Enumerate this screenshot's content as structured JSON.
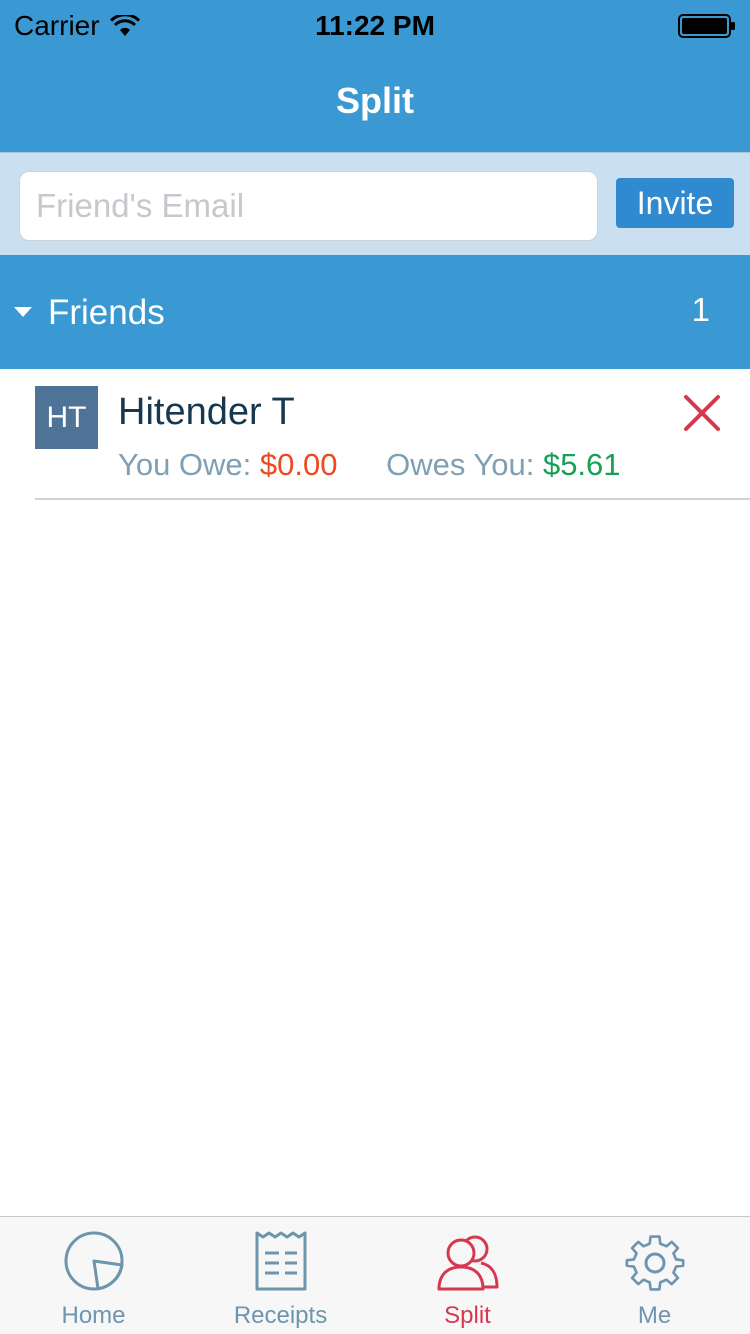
{
  "status_bar": {
    "carrier": "Carrier",
    "time": "11:22 PM"
  },
  "nav": {
    "title": "Split"
  },
  "invite": {
    "email_placeholder": "Friend's Email",
    "email_value": "",
    "button_label": "Invite"
  },
  "friends_section": {
    "title": "Friends",
    "count": "1",
    "friends": [
      {
        "initials": "HT",
        "name": "Hitender T",
        "you_owe_label": "You Owe:",
        "you_owe": "$0.00",
        "owes_you_label": "Owes You:",
        "owes_you": "$5.61"
      }
    ]
  },
  "tabbar": {
    "tabs": [
      {
        "label": "Home",
        "icon": "home-pie-icon"
      },
      {
        "label": "Receipts",
        "icon": "receipt-icon"
      },
      {
        "label": "Split",
        "icon": "friends-icon",
        "active": true
      },
      {
        "label": "Me",
        "icon": "gear-icon"
      }
    ]
  },
  "colors": {
    "primary": "#3a98d2",
    "owe": "#ec4a1e",
    "owed": "#18a055",
    "active_tab": "#d5384f",
    "inactive_tab": "#6d95ad"
  }
}
